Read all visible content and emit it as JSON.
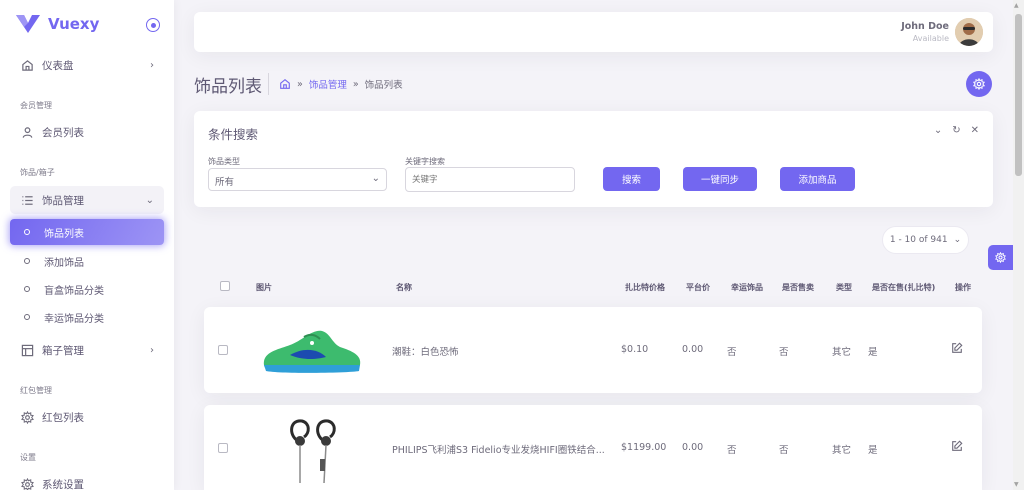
{
  "brand": {
    "name": "Vuexy",
    "color": "#7367f0"
  },
  "sidebar": {
    "items": [
      {
        "label": "仪表盘",
        "icon": "home-icon",
        "chevron": "›"
      },
      {
        "header": "会员管理"
      },
      {
        "label": "会员列表",
        "icon": "user-icon"
      },
      {
        "header": "饰品/箱子"
      },
      {
        "label": "饰品管理",
        "icon": "list-icon",
        "chevron": "⌄"
      },
      {
        "label": "饰品列表",
        "sub": true,
        "active": true
      },
      {
        "label": "添加饰品",
        "sub": true
      },
      {
        "label": "盲盒饰品分类",
        "sub": true
      },
      {
        "label": "幸运饰品分类",
        "sub": true
      },
      {
        "label": "箱子管理",
        "icon": "box-icon",
        "chevron": "›"
      },
      {
        "header": "红包管理"
      },
      {
        "label": "红包列表",
        "icon": "gear-icon"
      },
      {
        "header": "设置"
      },
      {
        "label": "系统设置",
        "icon": "gear-icon"
      }
    ]
  },
  "navbar": {
    "user_name": "John Doe",
    "user_status": "Available"
  },
  "page": {
    "title": "饰品列表",
    "breadcrumb": {
      "sep": "»",
      "parent": "饰品管理",
      "current": "饰品列表"
    }
  },
  "search": {
    "title": "条件搜索",
    "actions": [
      "⌄",
      "↻",
      "✕"
    ],
    "type_label": "饰品类型",
    "type_value": "所有",
    "keyword_label": "关键字搜索",
    "keyword_placeholder": "关键字",
    "btn_search": "搜索",
    "btn_sync": "一键同步",
    "btn_add": "添加商品"
  },
  "pagination": {
    "label": "1 - 10 of 941",
    "caret": "⌄"
  },
  "table": {
    "headers": {
      "image": "图片",
      "name": "名称",
      "zbt_price": "扎比特价格",
      "platform_price": "平台价",
      "lucky": "幸运饰品",
      "sale": "是否售卖",
      "type": "类型",
      "zbt_onsale": "是否在售(扎比特)",
      "action": "操作"
    },
    "rows": [
      {
        "name": "潮鞋：白色恐怖",
        "zbt_price": "$0.10",
        "platform_price": "0.00",
        "lucky": "否",
        "sale": "否",
        "type": "其它",
        "zbt_onsale": "是"
      },
      {
        "name": "PHILIPS飞利浦S3 Fidelio专业发烧HIFI圈铁结合...",
        "zbt_price": "$1199.00",
        "platform_price": "0.00",
        "lucky": "否",
        "sale": "否",
        "type": "其它",
        "zbt_onsale": "是"
      }
    ]
  }
}
